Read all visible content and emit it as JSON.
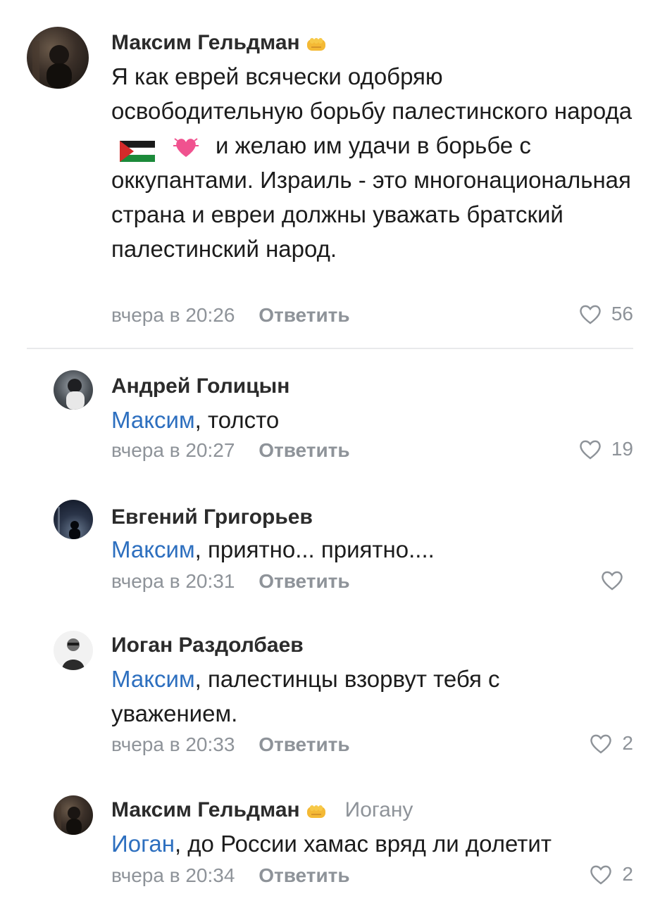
{
  "comments": [
    {
      "author": "Максим Гельдман",
      "reply_to": "",
      "text_parts": [
        "Я как еврей всячески одобряю освободительную борьбу палестинского народа",
        "и желаю им удачи в борьбе с оккупантами. Израиль - это многонациональная страна и евреи должны уважать братский палестинский народ."
      ],
      "time": "вчера в 20:26",
      "reply_label": "Ответить",
      "likes": "56"
    },
    {
      "author": "Андрей Голицын",
      "mention": "Максим",
      "text": ", толсто",
      "time": "вчера в 20:27",
      "reply_label": "Ответить",
      "likes": "19"
    },
    {
      "author": "Евгений Григорьев",
      "mention": "Максим",
      "text": ", приятно... приятно....",
      "time": "вчера в 20:31",
      "reply_label": "Ответить",
      "likes": ""
    },
    {
      "author": "Иоган Раздолбаев",
      "mention": "Максим",
      "text": ", палестинцы взорвут тебя с уважением.",
      "time": "вчера в 20:33",
      "reply_label": "Ответить",
      "likes": "2"
    },
    {
      "author": "Максим Гельдман",
      "reply_to": "Иогану",
      "mention": "Иоган",
      "text": ", до России хамас вряд ли долетит",
      "time": "вчера в 20:34",
      "reply_label": "Ответить",
      "likes": "2"
    }
  ],
  "icons": {
    "like": "heart-outline-icon",
    "badge": "fist-emoji-icon",
    "flag": "palestine-flag-emoji",
    "heart": "pink-heart-emoji"
  },
  "colors": {
    "mention": "#2d6fbf",
    "meta": "#8e9399",
    "text": "#1c1c1c"
  }
}
